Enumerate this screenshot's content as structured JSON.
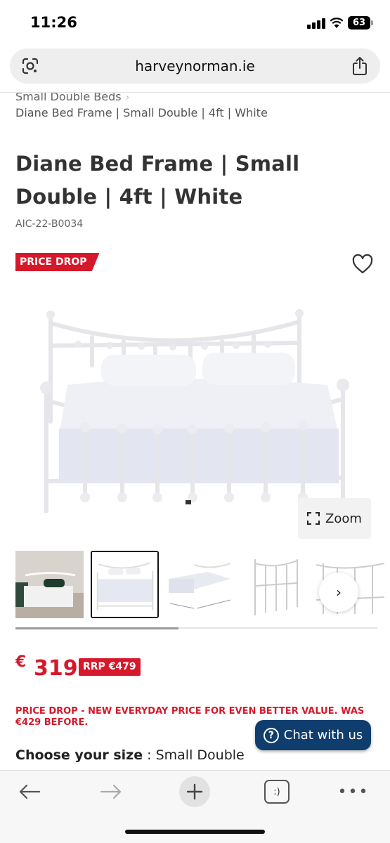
{
  "status_bar": {
    "time": "11:26",
    "battery": "63",
    "icons": [
      "signal-icon",
      "wifi-icon",
      "battery-icon"
    ]
  },
  "browser": {
    "url": "harveynorman.ie",
    "icons": [
      "google-lens-icon",
      "share-icon"
    ]
  },
  "breadcrumb": {
    "parent": "Small Double Beds",
    "separator": "›",
    "current": "Diane Bed Frame | Small Double | 4ft | White"
  },
  "product": {
    "title": "Diane Bed Frame | Small Double | 4ft | White",
    "sku": "AIC-22-B0034",
    "badge": "PRICE DROP",
    "wishlist_icon": "heart-outline-icon",
    "zoom_label": "Zoom",
    "thumbnail_next": "›",
    "thumbnail_count": 5,
    "selected_thumbnail": 2,
    "thumbnail_scroll_fraction": 0.45
  },
  "price": {
    "currency": "€",
    "amount": "319",
    "rrp": "RRP €479",
    "note": "PRICE DROP - NEW EVERYDAY PRICE FOR EVEN BETTER VALUE. WAS €429 BEFORE."
  },
  "size": {
    "label": "Choose your size",
    "separator": " : ",
    "value": "Small Double"
  },
  "chat": {
    "icon": "?",
    "label": "Chat with us"
  },
  "toolbar": {
    "back_icon": "←",
    "forward_icon": "→",
    "new_tab_icon": "+",
    "tabs_icon": ":)",
    "more_icon": "•••"
  },
  "colors": {
    "accent_red": "#d7182a",
    "chat_navy": "#0f3d6e"
  }
}
